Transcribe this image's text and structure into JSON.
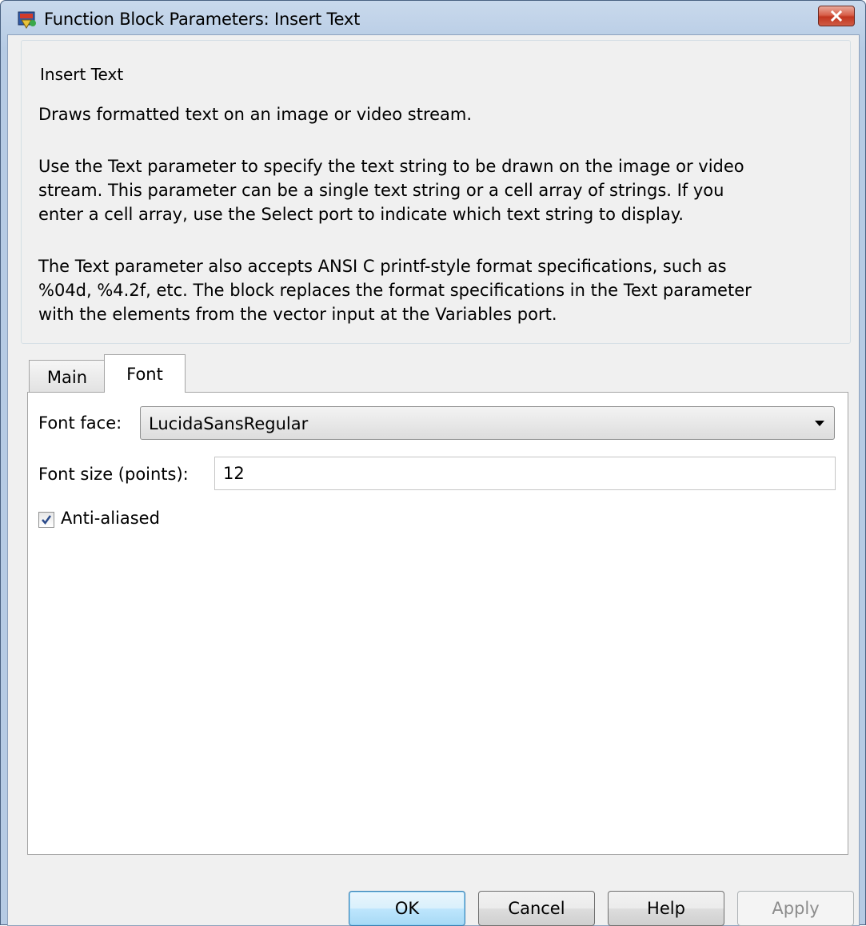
{
  "window": {
    "title": "Function Block Parameters: Insert Text",
    "close_icon": "close-x-icon",
    "app_icon": "simulink-block-icon"
  },
  "description": {
    "group_title": "Insert Text",
    "paragraphs": [
      "Draws formatted text on an image or video stream.",
      "Use the Text parameter to specify the text string to be drawn on the image or video\nstream. This parameter can be a single text string or a cell array of strings. If you\nenter a cell array, use the Select port to indicate which text string to display.",
      "The Text parameter also accepts ANSI C printf-style format specifications, such as\n%04d, %4.2f, etc. The block replaces the format specifications in the Text parameter\nwith the elements from the vector input at the Variables port."
    ]
  },
  "tabs": [
    {
      "label": "Main",
      "active": false
    },
    {
      "label": "Font",
      "active": true
    }
  ],
  "font_tab": {
    "font_face_label": "Font face:",
    "font_face_value": "LucidaSansRegular",
    "font_size_label": "Font size (points):",
    "font_size_value": "12",
    "anti_aliased_label": "Anti-aliased",
    "anti_aliased_checked": true
  },
  "buttons": {
    "ok": "OK",
    "cancel": "Cancel",
    "help": "Help",
    "apply": "Apply"
  },
  "colors": {
    "titlebar": "#b6cbe4",
    "dialog_bg": "#f0f0f0",
    "close_button": "#c2361f",
    "default_button_border": "#3c7fb1",
    "checkmark": "#2a4a8a"
  }
}
